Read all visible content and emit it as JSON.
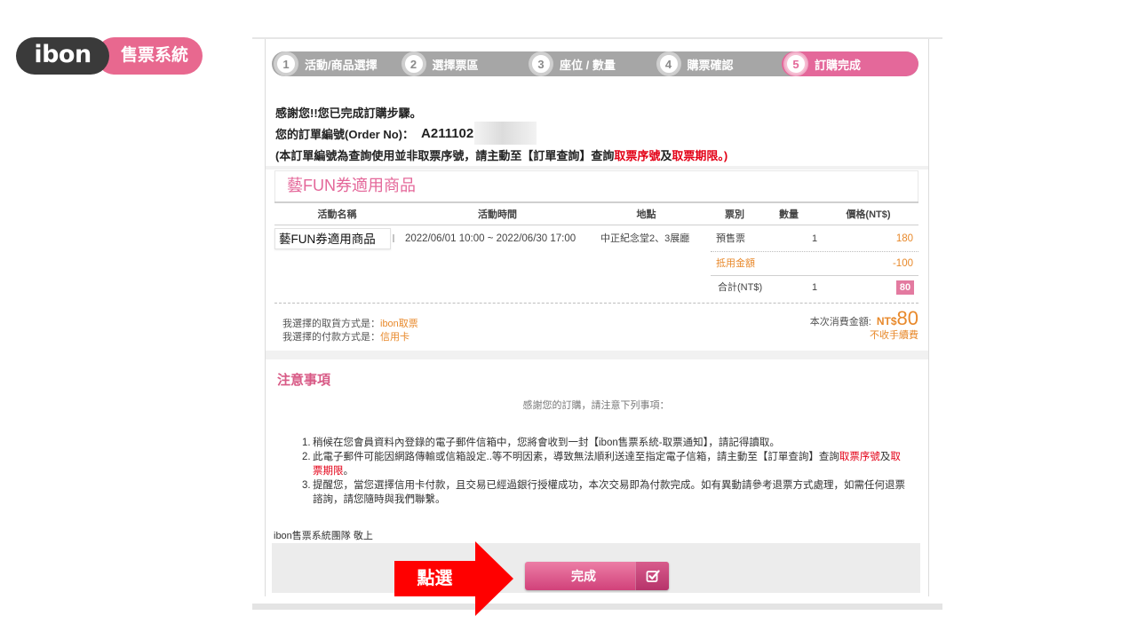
{
  "logo": {
    "brand": "ibon",
    "product": "售票系統"
  },
  "steps": [
    {
      "num": "1",
      "label": "活動/商品選擇",
      "active": false
    },
    {
      "num": "2",
      "label": "選擇票區",
      "active": false
    },
    {
      "num": "3",
      "label": "座位 / 數量",
      "active": false
    },
    {
      "num": "4",
      "label": "購票確認",
      "active": false
    },
    {
      "num": "5",
      "label": "訂購完成",
      "active": true
    }
  ],
  "confirmation": {
    "thanks": "感謝您!!您已完成訂購步驟。",
    "order_label": "您的訂單編號(Order No)：",
    "order_no": "A211102",
    "notice": {
      "prefix": "(本訂單編號為查詢使用並非取票序號，請主動至【訂單查詢】查詢",
      "highlight_1": "取票序號",
      "join": "及",
      "highlight_2": "取票期限",
      "suffix": "。)"
    }
  },
  "product_section": {
    "title": "藝FUN券適用商品",
    "columns": [
      "活動名稱",
      "活動時間",
      "地點",
      "票別",
      "數量",
      "價格(NT$)"
    ],
    "item": {
      "name": "藝FUN券適用商品",
      "time": "2022/06/01 10:00 ~ 2022/06/30 17:00",
      "venue": "中正紀念堂2、3展廳",
      "ticket_type": "預售票",
      "quantity": "1",
      "price": "180"
    },
    "discount": {
      "label": "抵用金額",
      "value": "-100"
    },
    "total": {
      "label": "合計(NT$)",
      "quantity": "1",
      "value": "80"
    }
  },
  "order_summary": {
    "delivery_label": "我選擇的取貨方式是：",
    "delivery_value": "ibon取票",
    "payment_label": "我選擇的付款方式是：",
    "payment_value": "信用卡",
    "amount_label": "本次消費金額:",
    "amount_currency": "NT$",
    "amount_value": "80",
    "fee_note": "不收手續費"
  },
  "notice": {
    "title": "注意事項",
    "intro": "感謝您的訂購，請注意下列事項：",
    "items": [
      {
        "number": "1.",
        "text": "稍候在您會員資料內登錄的電子郵件信箱中，您將會收到一封【ibon售票系統-取票通知】，請記得讀取。"
      },
      {
        "number": "2.",
        "text": "此電子郵件可能因網路傳輸或信箱設定..等不明因素，導致無法順利送達至指定電子信箱，請主動至【訂單查詢】查詢",
        "highlight_1": "取票序號",
        "join": "及",
        "highlight_2": "取票期限",
        "suffix": "。"
      },
      {
        "number": "3.",
        "text": "提醒您，當您選擇信用卡付款，且交易已經過銀行授權成功，本次交易即為付款完成。如有異動請參考退票方式處理，如需任何退票諮詢，請您隨時與我們聯繫。"
      }
    ]
  },
  "signature": "ibon售票系統團隊 敬上",
  "finish_button": {
    "label": "完成",
    "icon": "check-square-icon"
  },
  "callout": {
    "label": "點選",
    "icon": "right-arrow-icon"
  },
  "colors": {
    "brand_pink": "#e4689a",
    "price_orange": "#e8892b",
    "highlight_red": "#e30016",
    "step_gray": "#a6a6a6",
    "callout_red": "#ff0000"
  }
}
